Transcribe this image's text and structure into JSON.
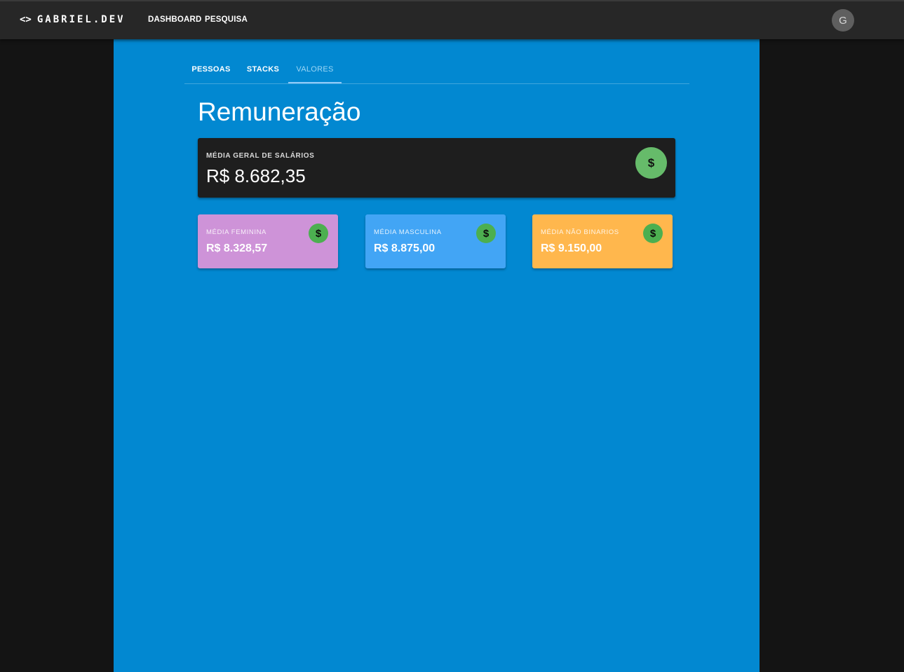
{
  "header": {
    "brand_icon": "<>",
    "brand": "GABRIEL.DEV",
    "nav": [
      {
        "label": "DASHBOARD"
      },
      {
        "label": "PESQUISA"
      }
    ],
    "avatar_initial": "G"
  },
  "tabs": [
    {
      "label": "PESSOAS"
    },
    {
      "label": "STACKS"
    },
    {
      "label": "VALORES",
      "active": true
    }
  ],
  "page": {
    "title": "Remuneração"
  },
  "summary": {
    "label": "MÉDIA GERAL DE SALÁRIOS",
    "value": "R$ 8.682,35",
    "icon": "dollar-icon"
  },
  "cards": [
    {
      "label": "MÉDIA FEMININA",
      "value": "R$ 8.328,57",
      "color": "#ce93d8",
      "icon": "dollar-icon"
    },
    {
      "label": "MÉDIA MASCULINA",
      "value": "R$ 8.875,00",
      "color": "#42a5f5",
      "icon": "dollar-icon"
    },
    {
      "label": "MÉDIA NÃO BINARIOS",
      "value": "R$ 9.150,00",
      "color": "#ffb74d",
      "icon": "dollar-icon"
    }
  ],
  "icon_glyph": "$",
  "colors": {
    "appbar": "#272727",
    "main": "#0288d1",
    "summary_card": "#1e1e1e",
    "coin": "#66bb6a"
  }
}
